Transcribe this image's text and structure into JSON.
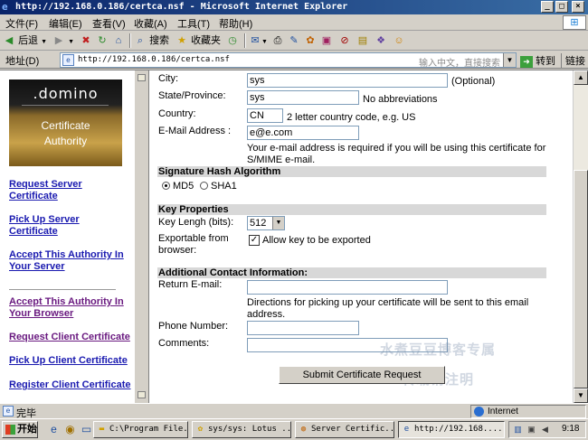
{
  "window": {
    "title": "http://192.168.0.186/certca.nsf - Microsoft Internet Explorer",
    "minimize": "_",
    "maximize": "□",
    "close": "×"
  },
  "menu": [
    "文件(F)",
    "编辑(E)",
    "查看(V)",
    "收藏(A)",
    "工具(T)",
    "帮助(H)"
  ],
  "toolbar": {
    "back": "后退",
    "search": "搜索",
    "favorites": "收藏夹"
  },
  "address": {
    "label": "地址(D)",
    "url": "http://192.168.0.186/certca.nsf",
    "ime_text": "输入中文，直接搜索",
    "go": "转到",
    "links": "链接"
  },
  "sidebar": {
    "logo": {
      "brand": ".domino",
      "line1": "Certificate",
      "line2": "Authority"
    },
    "links": [
      {
        "line1": "Request Server",
        "line2": "Certificate"
      },
      {
        "line1": "Pick Up Server",
        "line2": "Certificate"
      },
      {
        "line1": "Accept This Authority In",
        "line2": "Your Server"
      },
      {
        "line1": "Accept This Authority In",
        "line2": "Your Browser"
      },
      {
        "line1": "Request Client Certificate",
        "line2": ""
      },
      {
        "line1": "Pick Up Client Certificate",
        "line2": ""
      },
      {
        "line1": "Register Client Certificate",
        "line2": ""
      }
    ]
  },
  "form": {
    "city": {
      "label": "City:",
      "value": "sys",
      "note": "(Optional)"
    },
    "state": {
      "label": "State/Province:",
      "value": "sys",
      "note": "No abbreviations"
    },
    "country": {
      "label": "Country:",
      "value": "CN",
      "note": "2 letter country code, e.g. US"
    },
    "email": {
      "label": "E-Mail Address :",
      "value": "e@e.com",
      "note_line1": "Your e-mail address is required if you will be using this certificate for",
      "note_line2": "S/MIME e-mail."
    },
    "hash": {
      "heading": "Signature Hash Algorithm",
      "option1": "MD5",
      "option2": "SHA1"
    },
    "key": {
      "heading": "Key Properties",
      "length_label": "Key Lengh (bits):",
      "length_value": "512",
      "exportable_line1": "Exportable from",
      "exportable_line2": "browser:",
      "checkbox_mark": "✓",
      "checkbox_label": "Allow key to be exported"
    },
    "contact": {
      "heading": "Additional Contact Information:",
      "return_label": "Return E-mail:",
      "return_note_line1": "Directions for picking up your certificate will be sent to this email",
      "return_note_line2": "address.",
      "phone_label": "Phone Number:",
      "comments_label": "Comments:"
    },
    "submit": "Submit Certificate Request",
    "watermark1": "水煮豆豆博客专属",
    "watermark2": "转载请注明"
  },
  "status": {
    "text": "完毕",
    "zone": "Internet"
  },
  "taskbar": {
    "start": "开始",
    "tasks": [
      "C:\\Program File...",
      "sys/sys: Lotus ...",
      "Server Certific...",
      "http://192.168...."
    ],
    "clock": "9:18"
  }
}
